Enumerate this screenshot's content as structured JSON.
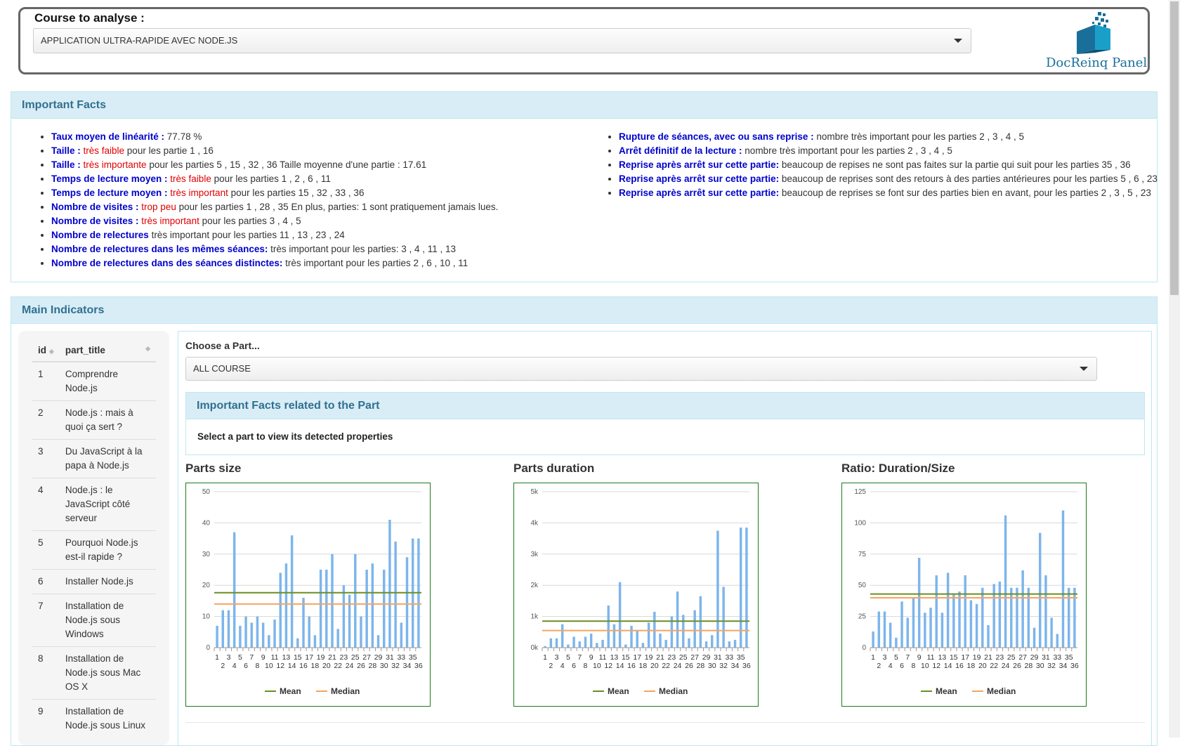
{
  "course": {
    "label": "Course to analyse :",
    "selected": "APPLICATION ULTRA-RAPIDE AVEC NODE.JS",
    "logo_text": "DocReinq Panel"
  },
  "important_facts": {
    "title": "Important Facts",
    "left": [
      {
        "key": "Taux moyen de linéarité :",
        "red": "",
        "rest": " 77.78 %"
      },
      {
        "key": "Taille :",
        "red": " très faible",
        "rest": " pour les partie 1 , 16"
      },
      {
        "key": "Taille :",
        "red": " très importante",
        "rest": " pour les parties 5 , 15 , 32 , 36 Taille moyenne d'une partie : 17.61"
      },
      {
        "key": "Temps de lecture moyen :",
        "red": " très faible",
        "rest": " pour les parties 1 , 2 , 6 , 11"
      },
      {
        "key": "Temps de lecture moyen :",
        "red": " très important",
        "rest": " pour les parties 15 , 32 , 33 , 36"
      },
      {
        "key": "Nombre de visites :",
        "red": " trop peu",
        "rest": " pour les parties 1 , 28 , 35 En plus, parties: 1 sont pratiquement jamais lues."
      },
      {
        "key": "Nombre de visites :",
        "red": " très important",
        "rest": " pour les parties 3 , 4 , 5"
      },
      {
        "key": "Nombre de relectures",
        "red": "",
        "rest": " très important pour les parties 11 , 13 , 23 , 24"
      },
      {
        "key": "Nombre de relectures dans les mêmes séances:",
        "red": "",
        "rest": " très important pour les parties: 3 , 4 , 11 , 13"
      },
      {
        "key": "Nombre de relectures dans des séances distinctes:",
        "red": "",
        "rest": " très important pour les parties 2 , 6 , 10 , 11"
      }
    ],
    "right": [
      {
        "key": "Rupture de séances, avec ou sans reprise :",
        "red": "",
        "rest": " nombre très important pour les parties 2 , 3 , 4 , 5"
      },
      {
        "key": "Arrêt définitif de la lecture :",
        "red": "",
        "rest": " nombre très important pour les parties 2 , 3 , 4 , 5"
      },
      {
        "key": "Reprise après arrêt sur cette partie:",
        "red": "",
        "rest": " beaucoup de repises ne sont pas faites sur la partie qui suit pour les parties 35 , 36"
      },
      {
        "key": "Reprise après arrêt sur cette partie:",
        "red": "",
        "rest": " beaucoup de reprises sont des retours à des parties antérieures pour les parties 5 , 6 , 23"
      },
      {
        "key": "Reprise après arrêt sur cette partie:",
        "red": "",
        "rest": " beaucoup de reprises se font sur des parties bien en avant, pour les parties 2 , 3 , 5 , 23"
      }
    ]
  },
  "main_indicators": {
    "title": "Main Indicators",
    "table": {
      "col_id": "id",
      "col_title": "part_title",
      "rows": [
        {
          "id": "1",
          "title": "Comprendre Node.js"
        },
        {
          "id": "2",
          "title": "Node.js : mais à quoi ça sert ?"
        },
        {
          "id": "3",
          "title": "Du JavaScript à la papa à Node.js"
        },
        {
          "id": "4",
          "title": "Node.js : le JavaScript côté serveur"
        },
        {
          "id": "5",
          "title": "Pourquoi Node.js est-il rapide ?"
        },
        {
          "id": "6",
          "title": "Installer Node.js"
        },
        {
          "id": "7",
          "title": "Installation de Node.js sous Windows"
        },
        {
          "id": "8",
          "title": "Installation de Node.js sous Mac OS X"
        },
        {
          "id": "9",
          "title": "Installation de Node.js sous Linux"
        }
      ]
    },
    "part_label": "Choose a Part...",
    "part_selected": "ALL COURSE",
    "part_facts_title": "Important Facts related to the Part",
    "part_facts_text": "Select a part to view its detected properties"
  },
  "chart_data": [
    {
      "type": "bar",
      "title": "Parts size",
      "x": [
        1,
        2,
        3,
        4,
        5,
        6,
        7,
        8,
        9,
        10,
        11,
        12,
        13,
        14,
        15,
        16,
        17,
        18,
        19,
        20,
        21,
        22,
        23,
        24,
        25,
        26,
        27,
        28,
        29,
        30,
        31,
        32,
        33,
        34,
        35,
        36
      ],
      "values": [
        7,
        12,
        12,
        37,
        7,
        10,
        8,
        10,
        8,
        4,
        9,
        24,
        27,
        36,
        3,
        16,
        10,
        4,
        25,
        25,
        30,
        6,
        20,
        17,
        30,
        10,
        25,
        27,
        4,
        25,
        41,
        34,
        8,
        29,
        35,
        35
      ],
      "ylim": [
        0,
        50
      ],
      "yticks": [
        "0",
        "10",
        "20",
        "30",
        "40",
        "50"
      ],
      "mean": 17.61,
      "median": 14,
      "legend": [
        "Mean",
        "Median"
      ],
      "colors": {
        "bar": "#7cb5ec",
        "mean": "#6b8e23",
        "median": "#f4a460"
      }
    },
    {
      "type": "bar",
      "title": "Parts duration",
      "x": [
        1,
        2,
        3,
        4,
        5,
        6,
        7,
        8,
        9,
        10,
        11,
        12,
        13,
        14,
        15,
        16,
        17,
        18,
        19,
        20,
        21,
        22,
        23,
        24,
        25,
        26,
        27,
        28,
        29,
        30,
        31,
        32,
        33,
        34,
        35,
        36
      ],
      "values": [
        50,
        300,
        300,
        750,
        100,
        350,
        200,
        350,
        450,
        150,
        250,
        1350,
        750,
        2100,
        100,
        700,
        550,
        150,
        800,
        1150,
        450,
        250,
        1000,
        1800,
        1050,
        300,
        1200,
        1650,
        200,
        400,
        3750,
        1950,
        200,
        250,
        3850,
        3850
      ],
      "ylim": [
        0,
        5000
      ],
      "yticks": [
        "0k",
        "1k",
        "2k",
        "3k",
        "4k",
        "5k"
      ],
      "mean": 850,
      "median": 550,
      "legend": [
        "Mean",
        "Median"
      ],
      "colors": {
        "bar": "#7cb5ec",
        "mean": "#6b8e23",
        "median": "#f4a460"
      }
    },
    {
      "type": "bar",
      "title": "Ratio: Duration/Size",
      "x": [
        1,
        2,
        3,
        4,
        5,
        6,
        7,
        8,
        9,
        10,
        11,
        12,
        13,
        14,
        15,
        16,
        17,
        18,
        19,
        20,
        21,
        22,
        23,
        24,
        25,
        26,
        27,
        28,
        29,
        30,
        31,
        32,
        33,
        34,
        35,
        36
      ],
      "values": [
        13,
        29,
        29,
        20,
        8,
        37,
        24,
        40,
        72,
        28,
        32,
        58,
        28,
        60,
        43,
        45,
        58,
        38,
        35,
        48,
        18,
        51,
        53,
        106,
        48,
        48,
        62,
        48,
        16,
        92,
        58,
        24,
        11,
        110,
        48,
        48
      ],
      "ylim": [
        0,
        125
      ],
      "yticks": [
        "0",
        "25",
        "50",
        "75",
        "100",
        "125"
      ],
      "mean": 43,
      "median": 40,
      "legend": [
        "Mean",
        "Median"
      ],
      "colors": {
        "bar": "#7cb5ec",
        "mean": "#6b8e23",
        "median": "#f4a460"
      }
    }
  ]
}
